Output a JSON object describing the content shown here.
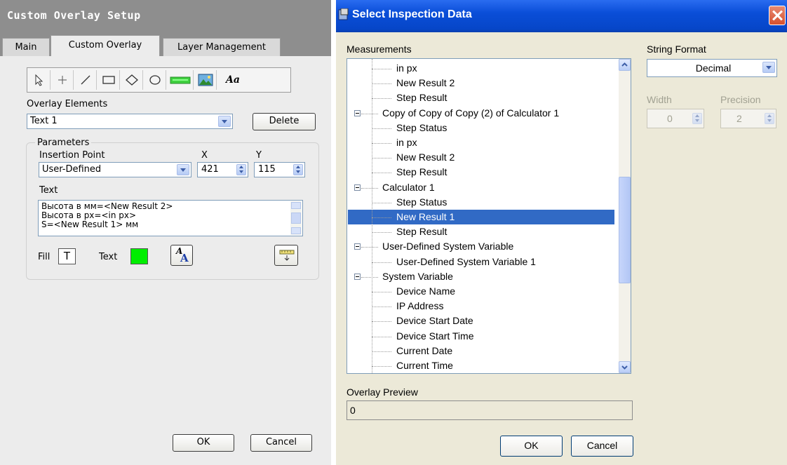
{
  "left_window": {
    "title": "Custom Overlay Setup",
    "tabs": [
      "Main",
      "Custom Overlay",
      "Layer Management"
    ],
    "toolbar_tools": [
      "pointer-icon",
      "crosshair-icon",
      "line-icon",
      "rectangle-icon",
      "diamond-icon",
      "ellipse-icon",
      "bar-icon",
      "image-icon",
      "text-tool-icon"
    ],
    "text_tool_label": "Aa",
    "overlay_elements_label": "Overlay Elements",
    "overlay_elements_value": "Text 1",
    "delete_label": "Delete",
    "parameters_label": "Parameters",
    "insertion_point_label": "Insertion Point",
    "insertion_point_value": "User-Defined",
    "x_label": "X",
    "y_label": "Y",
    "x_value": "421",
    "y_value": "115",
    "text_label": "Text",
    "text_lines": [
      "Высота в мм=<New Result 2>",
      "Высота в px=<in px>",
      "S=<New Result 1> мм"
    ],
    "fill_label": "Fill",
    "fill_glyph": "T",
    "text_color_label": "Text",
    "text_color": "#00ee00",
    "font_button_label": "A",
    "ok_label": "OK",
    "cancel_label": "Cancel"
  },
  "dialog": {
    "title": "Select Inspection Data",
    "measurements_label": "Measurements",
    "tree": [
      {
        "label": "in px",
        "level": 1
      },
      {
        "label": "New Result 2",
        "level": 1
      },
      {
        "label": "Step Result",
        "level": 1
      },
      {
        "label": "Copy of Copy of Copy (2) of Calculator 1",
        "level": 0
      },
      {
        "label": "Step Status",
        "level": 1
      },
      {
        "label": "in px",
        "level": 1
      },
      {
        "label": "New Result 2",
        "level": 1
      },
      {
        "label": "Step Result",
        "level": 1
      },
      {
        "label": "Calculator 1",
        "level": 0
      },
      {
        "label": "Step Status",
        "level": 1
      },
      {
        "label": "New Result 1",
        "level": 1,
        "selected": true
      },
      {
        "label": "Step Result",
        "level": 1
      },
      {
        "label": "User-Defined System Variable",
        "level": 0
      },
      {
        "label": "User-Defined System Variable 1",
        "level": 1
      },
      {
        "label": "System Variable",
        "level": 0
      },
      {
        "label": "Device Name",
        "level": 1
      },
      {
        "label": "IP Address",
        "level": 1
      },
      {
        "label": "Device Start Date",
        "level": 1
      },
      {
        "label": "Device Start Time",
        "level": 1
      },
      {
        "label": "Current Date",
        "level": 1
      },
      {
        "label": "Current Time",
        "level": 1
      }
    ],
    "string_format_label": "String Format",
    "string_format_value": "Decimal",
    "width_label": "Width",
    "width_value": "0",
    "precision_label": "Precision",
    "precision_value": "2",
    "overlay_preview_label": "Overlay Preview",
    "overlay_preview_value": "0",
    "ok_label": "OK",
    "cancel_label": "Cancel"
  }
}
